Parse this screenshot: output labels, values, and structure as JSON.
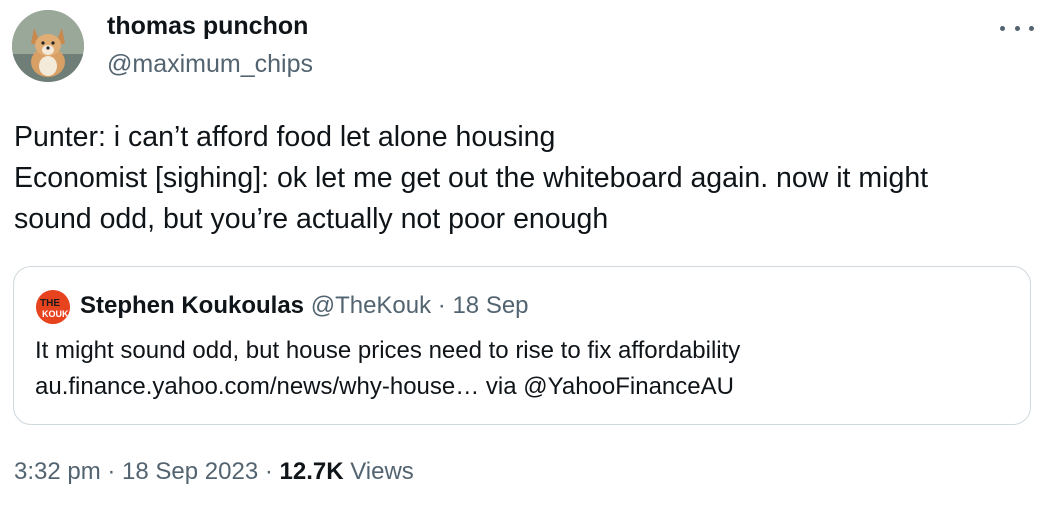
{
  "author": {
    "name": "thomas punchon",
    "handle": "@maximum_chips"
  },
  "tweet": {
    "lines": [
      "Punter: i can’t afford food let alone housing",
      "Economist [sighing]: ok let me get out the whiteboard again. now it might",
      "sound odd, but you’re actually not poor enough"
    ]
  },
  "quote": {
    "name": "Stephen Koukoulas",
    "handle": "@TheKouk",
    "separator": " · ",
    "date": "18 Sep",
    "avatar_text": "THE KOUK",
    "lines": [
      "It might sound odd, but house prices need to rise to fix affordability",
      "au.finance.yahoo.com/news/why-house… via @YahooFinanceAU"
    ]
  },
  "footer": {
    "time": "3:32 pm",
    "date": "18 Sep 2023",
    "separator": " · ",
    "views_count": "12.7K",
    "views_label": "Views"
  },
  "icons": {
    "more": "more-horizontal-icon"
  },
  "colors": {
    "text": "#0f1419",
    "secondary": "#536471",
    "border": "#cfd9de",
    "quote_avatar": "#e8431f"
  }
}
